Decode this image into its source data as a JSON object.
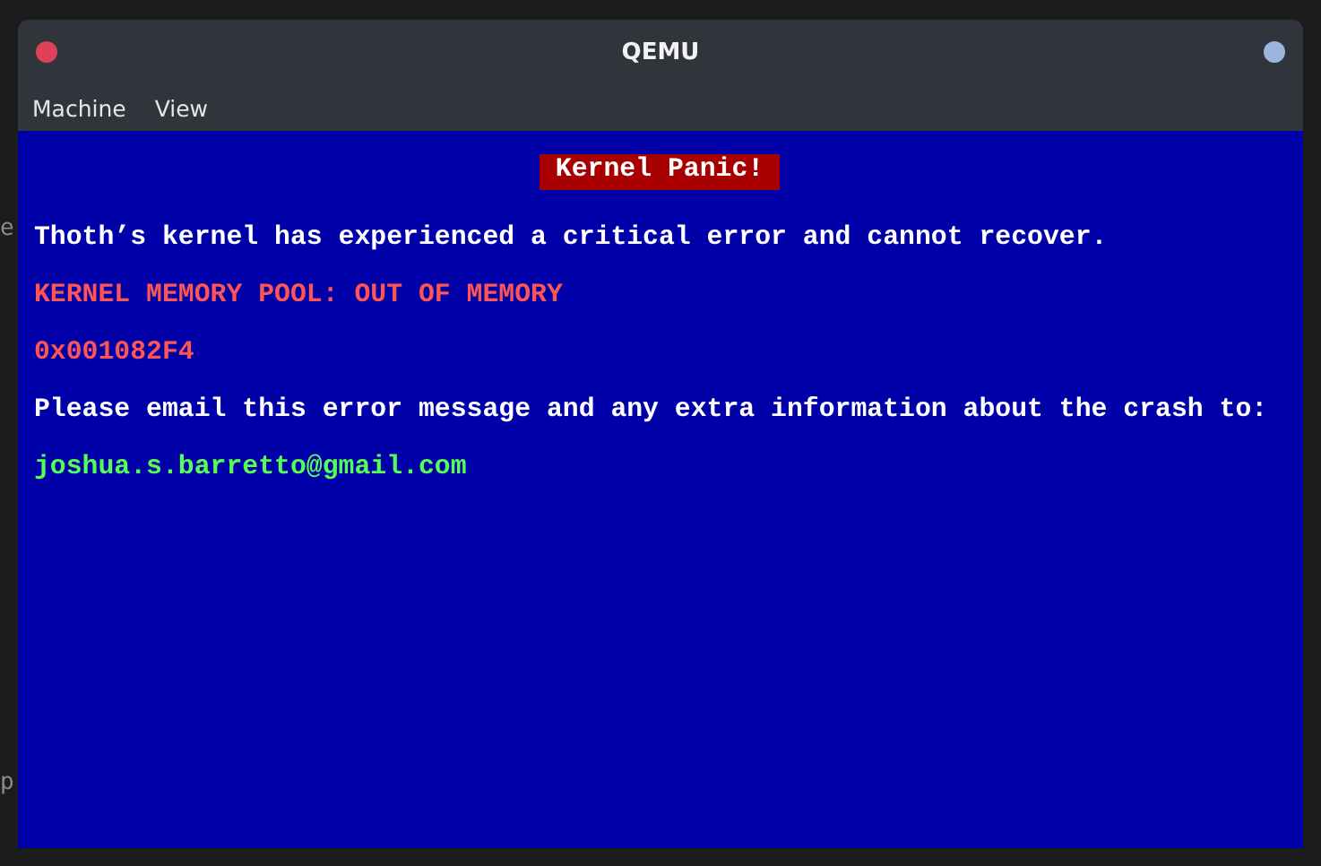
{
  "background_terminal": {
    "lines": [
      "e",
      "p"
    ]
  },
  "window": {
    "title": "QEMU",
    "menu": [
      "Machine",
      "View"
    ]
  },
  "screen": {
    "banner": "Kernel Panic!",
    "lines": [
      {
        "kind": "normal",
        "text": "Thoth’s kernel has experienced a critical error and cannot recover."
      },
      {
        "kind": "error",
        "text": "KERNEL MEMORY POOL: OUT OF MEMORY"
      },
      {
        "kind": "error",
        "text": "0x001082F4"
      },
      {
        "kind": "normal",
        "text": "Please email this error message and any extra information about the crash to:"
      },
      {
        "kind": "contact",
        "text": "joshua.s.barretto@gmail.com"
      }
    ]
  }
}
